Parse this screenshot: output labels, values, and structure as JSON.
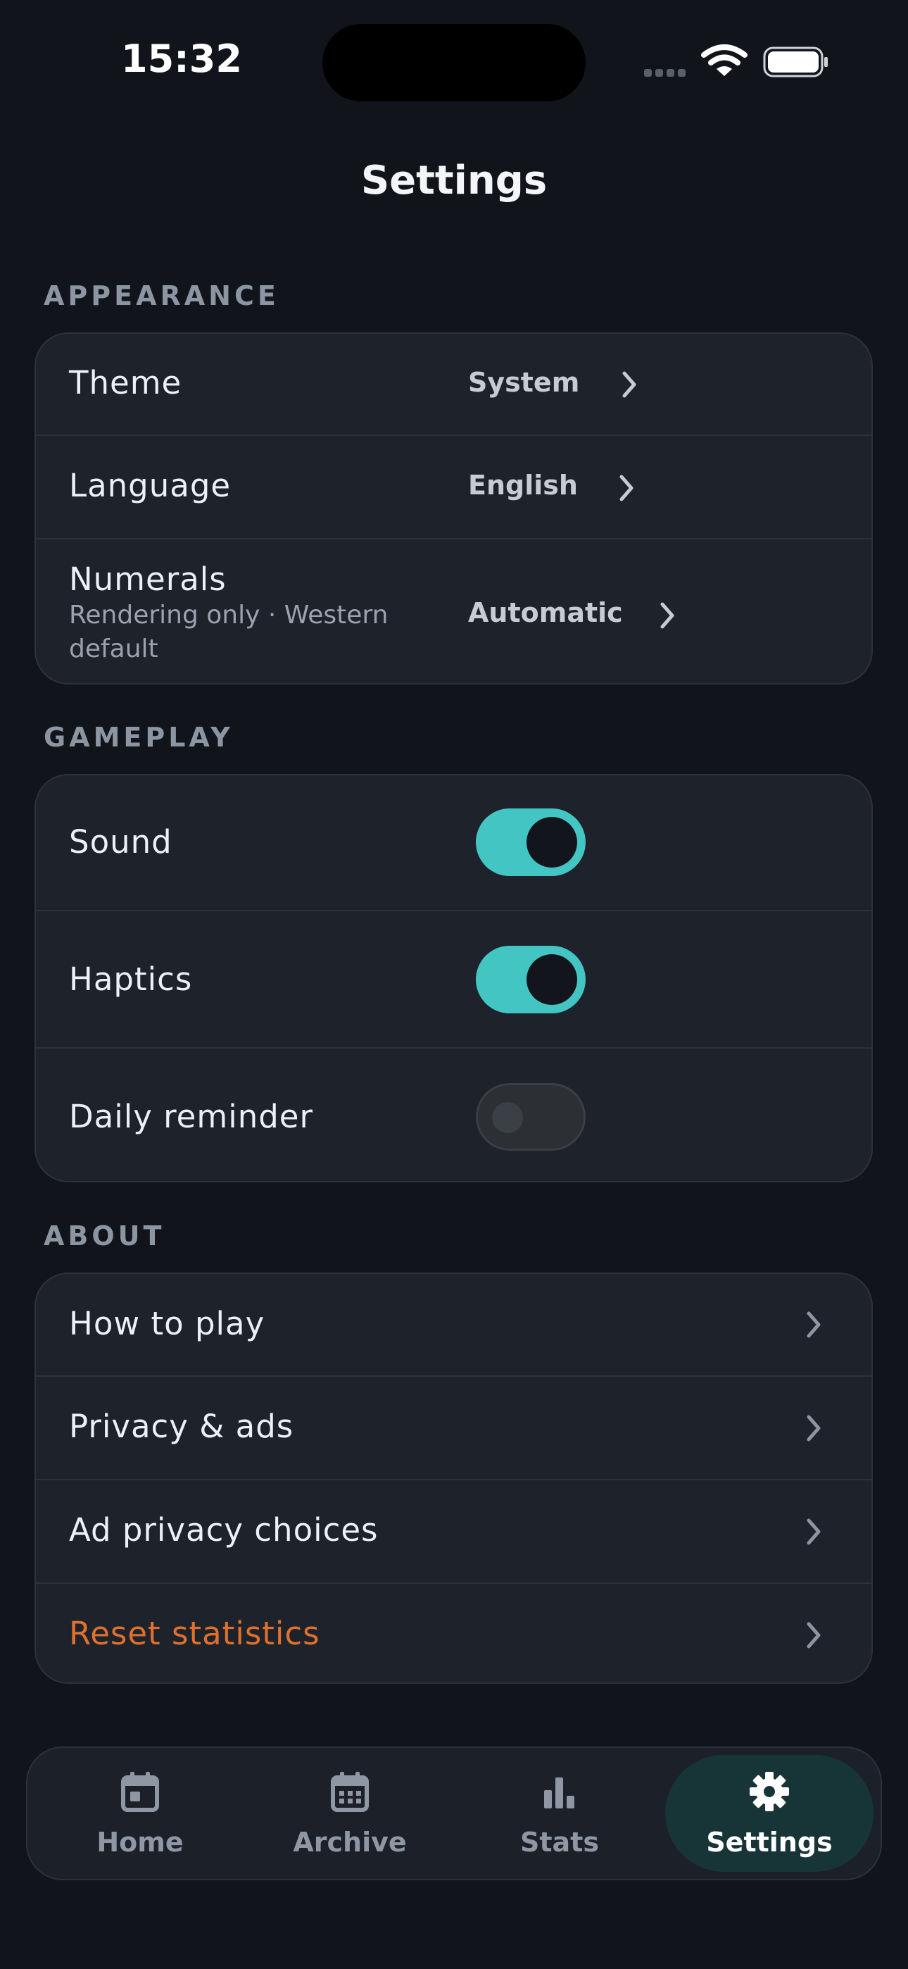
{
  "status_bar": {
    "time": "15:32",
    "battery_icon": "battery-full-icon",
    "wifi_icon": "wifi-icon"
  },
  "title": "Settings",
  "sections": {
    "appearance": {
      "label": "APPEARANCE",
      "rows": [
        {
          "label": "Theme",
          "value": "System"
        },
        {
          "label": "Language",
          "value": "English"
        },
        {
          "label": "Numerals",
          "sublabel": "Rendering only · Western default",
          "value": "Automatic"
        }
      ]
    },
    "gameplay": {
      "label": "GAMEPLAY",
      "rows": [
        {
          "label": "Sound",
          "on": true
        },
        {
          "label": "Haptics",
          "on": true
        },
        {
          "label": "Daily reminder",
          "on": false
        }
      ]
    },
    "about": {
      "label": "ABOUT",
      "rows": [
        {
          "label": "How to play"
        },
        {
          "label": "Privacy & ads"
        },
        {
          "label": "Ad privacy choices"
        },
        {
          "label": "Reset statistics",
          "danger": true
        }
      ]
    }
  },
  "tabs": [
    {
      "label": "Home",
      "icon": "calendar-icon"
    },
    {
      "label": "Archive",
      "icon": "calendar-grid-icon"
    },
    {
      "label": "Stats",
      "icon": "bar-chart-icon"
    },
    {
      "label": "Settings",
      "icon": "gear-icon",
      "active": true
    }
  ],
  "colors": {
    "accent": "#43c6c3",
    "danger": "#e0712c",
    "background": "#11141a",
    "card": "#1d222b"
  }
}
